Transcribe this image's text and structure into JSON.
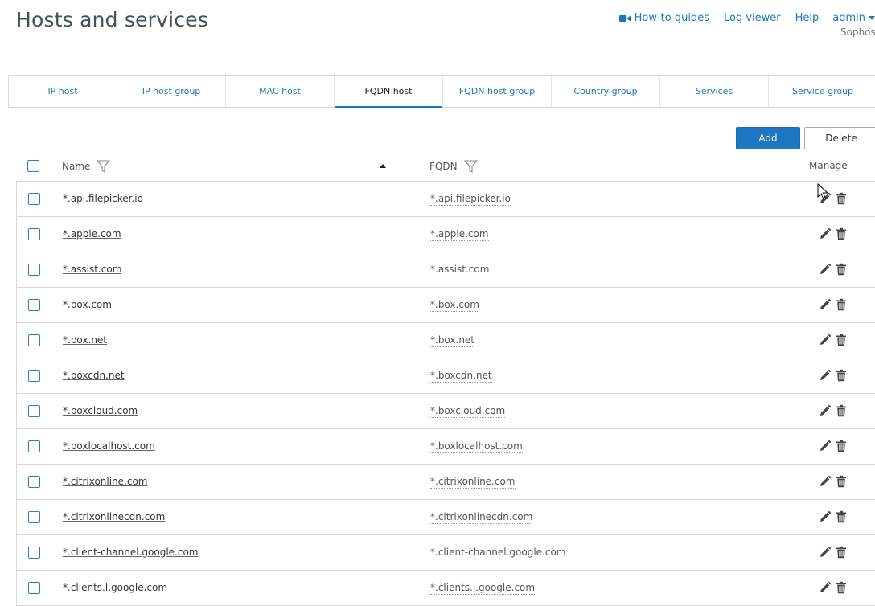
{
  "header": {
    "title": "Hosts and services",
    "links": {
      "howto": "How-to guides",
      "log_viewer": "Log viewer",
      "help": "Help",
      "admin": "admin"
    },
    "org": "Sophos"
  },
  "tabs": [
    {
      "label": "IP host",
      "active": false
    },
    {
      "label": "IP host group",
      "active": false
    },
    {
      "label": "MAC host",
      "active": false
    },
    {
      "label": "FQDN host",
      "active": true
    },
    {
      "label": "FQDN host group",
      "active": false
    },
    {
      "label": "Country group",
      "active": false
    },
    {
      "label": "Services",
      "active": false
    },
    {
      "label": "Service group",
      "active": false
    }
  ],
  "toolbar": {
    "add_label": "Add",
    "delete_label": "Delete"
  },
  "table": {
    "columns": {
      "name": "Name",
      "fqdn": "FQDN",
      "manage": "Manage"
    },
    "rows": [
      {
        "name": "*.api.filepicker.io",
        "fqdn": "*.api.filepicker.io"
      },
      {
        "name": "*.apple.com",
        "fqdn": "*.apple.com"
      },
      {
        "name": "*.assist.com",
        "fqdn": "*.assist.com"
      },
      {
        "name": "*.box.com",
        "fqdn": "*.box.com"
      },
      {
        "name": "*.box.net",
        "fqdn": "*.box.net"
      },
      {
        "name": "*.boxcdn.net",
        "fqdn": "*.boxcdn.net"
      },
      {
        "name": "*.boxcloud.com",
        "fqdn": "*.boxcloud.com"
      },
      {
        "name": "*.boxlocalhost.com",
        "fqdn": "*.boxlocalhost.com"
      },
      {
        "name": "*.citrixonline.com",
        "fqdn": "*.citrixonline.com"
      },
      {
        "name": "*.citrixonlinecdn.com",
        "fqdn": "*.citrixonlinecdn.com"
      },
      {
        "name": "*.client-channel.google.com",
        "fqdn": "*.client-channel.google.com"
      },
      {
        "name": "*.clients.l.google.com",
        "fqdn": "*.clients.l.google.com"
      }
    ]
  },
  "colors": {
    "accent": "#1d76c1",
    "border": "#d8d8d8",
    "title": "#44505c"
  }
}
